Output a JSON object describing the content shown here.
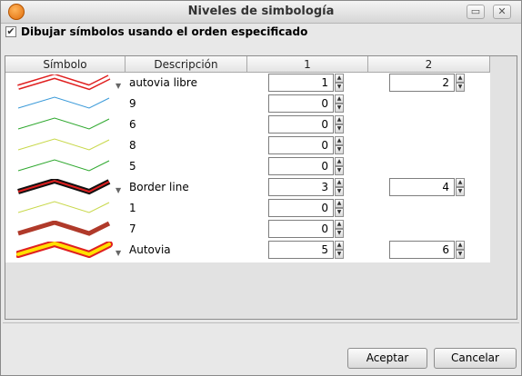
{
  "window": {
    "title": "Niveles de simbología"
  },
  "options": {
    "draw_in_order_label": "Dibujar símbolos usando el orden especificado",
    "draw_in_order_checked": true
  },
  "table": {
    "columns": [
      "Símbolo",
      "Descripción",
      "1",
      "2"
    ],
    "rows": [
      {
        "symbol": "double-red-outline-line",
        "description": "autovia libre",
        "level1": "1",
        "level2": "2"
      },
      {
        "symbol": "thin-blue-line",
        "description": "9",
        "level1": "0",
        "level2": null
      },
      {
        "symbol": "thin-green-line",
        "description": "6",
        "level1": "0",
        "level2": null
      },
      {
        "symbol": "thin-yellow-green-line",
        "description": "8",
        "level1": "0",
        "level2": null
      },
      {
        "symbol": "thin-green-line",
        "description": "5",
        "level1": "0",
        "level2": null
      },
      {
        "symbol": "black-red-border-line",
        "description": "Border line",
        "level1": "3",
        "level2": "4"
      },
      {
        "symbol": "thin-yellow-green-line",
        "description": "1",
        "level1": "0",
        "level2": null
      },
      {
        "symbol": "thick-brown-line",
        "description": "7",
        "level1": "0",
        "level2": null
      },
      {
        "symbol": "yellow-red-outline-line",
        "description": "Autovia",
        "level1": "5",
        "level2": "6"
      }
    ]
  },
  "buttons": {
    "accept": "Aceptar",
    "cancel": "Cancelar"
  },
  "colors": {
    "red": "#e02020",
    "blue": "#3a9ad9",
    "green": "#2ea82e",
    "yellowgreen": "#c8d84a",
    "brown": "#b03a2a",
    "yellow": "#ffe000"
  }
}
